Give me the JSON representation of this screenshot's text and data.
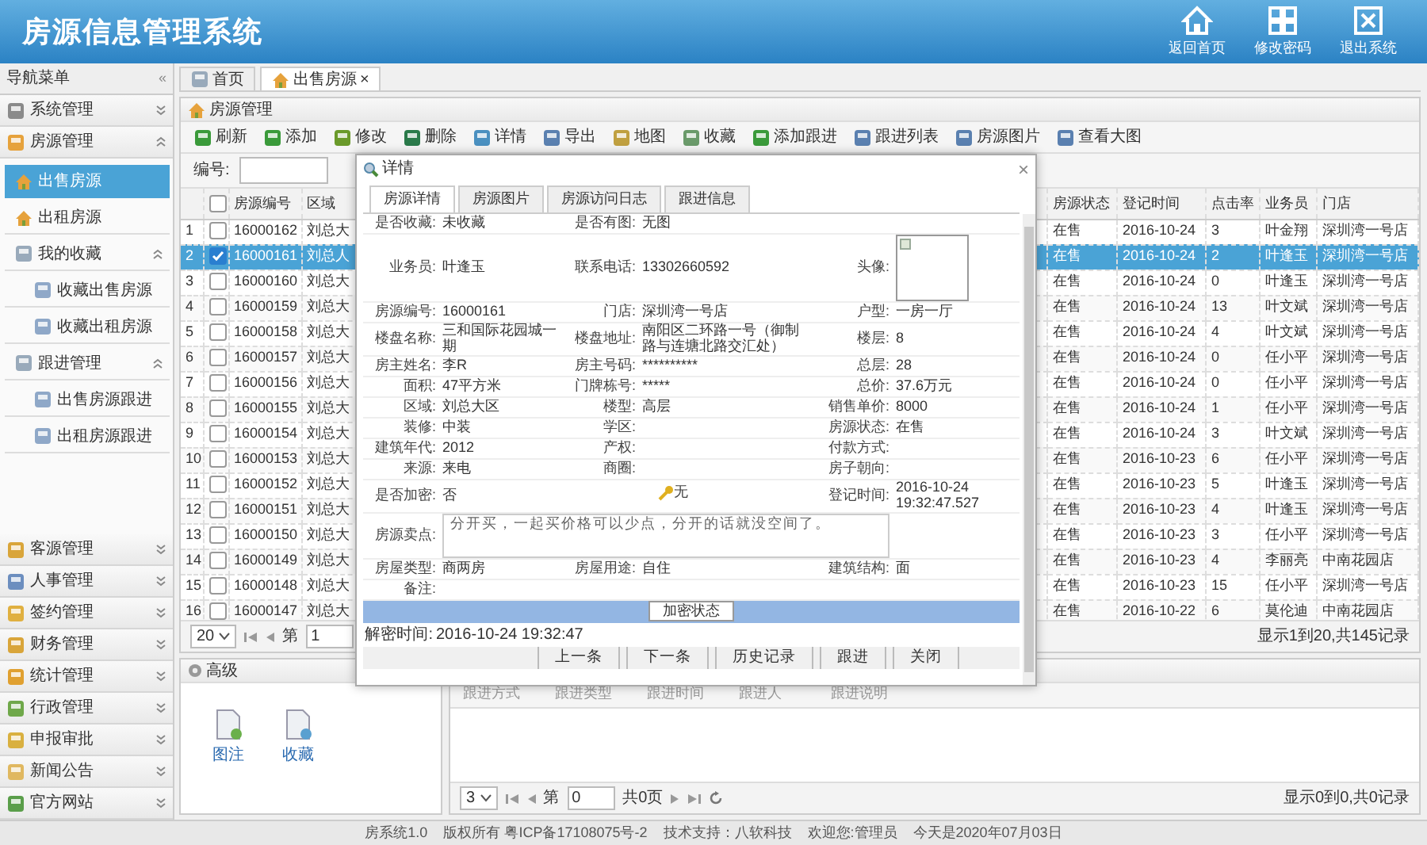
{
  "app_title": "房源信息管理系统",
  "header_buttons": [
    {
      "label": "返回首页"
    },
    {
      "label": "修改密码"
    },
    {
      "label": "退出系统"
    }
  ],
  "sidebar": {
    "title": "导航菜单",
    "collapse": "«",
    "sections": [
      {
        "label": "系统管理",
        "expanded": false
      },
      {
        "label": "房源管理",
        "expanded": true,
        "children": [
          {
            "label": "出售房源",
            "selected": true
          },
          {
            "label": "出租房源",
            "selected": false
          },
          {
            "label": "我的收藏",
            "selected": false,
            "expanded": true,
            "children": [
              {
                "label": "收藏出售房源",
                "selected": false
              },
              {
                "label": "收藏出租房源",
                "selected": false
              }
            ]
          },
          {
            "label": "跟进管理",
            "selected": false,
            "expanded": true,
            "children": [
              {
                "label": "出售房源跟进",
                "selected": false
              },
              {
                "label": "出租房源跟进",
                "selected": false
              }
            ]
          }
        ]
      },
      {
        "label": "客源管理",
        "expanded": false
      },
      {
        "label": "人事管理",
        "expanded": false
      },
      {
        "label": "签约管理",
        "expanded": false
      },
      {
        "label": "财务管理",
        "expanded": false
      },
      {
        "label": "统计管理",
        "expanded": false
      },
      {
        "label": "行政管理",
        "expanded": false
      },
      {
        "label": "申报审批",
        "expanded": false
      },
      {
        "label": "新闻公告",
        "expanded": false
      },
      {
        "label": "官方网站",
        "expanded": false
      }
    ]
  },
  "tabs": [
    {
      "label": "首页",
      "selected": false,
      "closable": false
    },
    {
      "label": "出售房源",
      "selected": true,
      "closable": true,
      "close": "×"
    }
  ],
  "panel_title": "房源管理",
  "toolbar": [
    "刷新",
    "添加",
    "修改",
    "删除",
    "详情",
    "导出",
    "地图",
    "收藏",
    "添加跟进",
    "跟进列表",
    "房源图片",
    "查看大图"
  ],
  "search": {
    "label": "编号:"
  },
  "table": {
    "all_checked": false,
    "columns": [
      "房源编号",
      "区域",
      "房源状态",
      "登记时间",
      "点击率",
      "业务员",
      "门店"
    ],
    "rows": [
      {
        "index": "1",
        "checked": false,
        "selected": false,
        "cells": [
          "16000162",
          "刘总大",
          "在售",
          "2016-10-24",
          "3",
          "叶金翔",
          "深圳湾一号店"
        ]
      },
      {
        "index": "2",
        "checked": true,
        "selected": true,
        "cells": [
          "16000161",
          "刘总人",
          "在售",
          "2016-10-24",
          "2",
          "叶逢玉",
          "深圳湾一号店"
        ]
      },
      {
        "index": "3",
        "checked": false,
        "selected": false,
        "cells": [
          "16000160",
          "刘总大",
          "在售",
          "2016-10-24",
          "0",
          "叶逢玉",
          "深圳湾一号店"
        ]
      },
      {
        "index": "4",
        "checked": false,
        "selected": false,
        "cells": [
          "16000159",
          "刘总大",
          "在售",
          "2016-10-24",
          "13",
          "叶文斌",
          "深圳湾一号店"
        ]
      },
      {
        "index": "5",
        "checked": false,
        "selected": false,
        "cells": [
          "16000158",
          "刘总大",
          "在售",
          "2016-10-24",
          "4",
          "叶文斌",
          "深圳湾一号店"
        ]
      },
      {
        "index": "6",
        "checked": false,
        "selected": false,
        "cells": [
          "16000157",
          "刘总大",
          "在售",
          "2016-10-24",
          "0",
          "任小平",
          "深圳湾一号店"
        ]
      },
      {
        "index": "7",
        "checked": false,
        "selected": false,
        "cells": [
          "16000156",
          "刘总大",
          "在售",
          "2016-10-24",
          "0",
          "任小平",
          "深圳湾一号店"
        ]
      },
      {
        "index": "8",
        "checked": false,
        "selected": false,
        "cells": [
          "16000155",
          "刘总大",
          "在售",
          "2016-10-24",
          "1",
          "任小平",
          "深圳湾一号店"
        ]
      },
      {
        "index": "9",
        "checked": false,
        "selected": false,
        "cells": [
          "16000154",
          "刘总大",
          "在售",
          "2016-10-24",
          "3",
          "叶文斌",
          "深圳湾一号店"
        ]
      },
      {
        "index": "10",
        "checked": false,
        "selected": false,
        "cells": [
          "16000153",
          "刘总大",
          "在售",
          "2016-10-23",
          "6",
          "任小平",
          "深圳湾一号店"
        ]
      },
      {
        "index": "11",
        "checked": false,
        "selected": false,
        "cells": [
          "16000152",
          "刘总大",
          "在售",
          "2016-10-23",
          "5",
          "叶逢玉",
          "深圳湾一号店"
        ]
      },
      {
        "index": "12",
        "checked": false,
        "selected": false,
        "cells": [
          "16000151",
          "刘总大",
          "在售",
          "2016-10-23",
          "4",
          "叶逢玉",
          "深圳湾一号店"
        ]
      },
      {
        "index": "13",
        "checked": false,
        "selected": false,
        "cells": [
          "16000150",
          "刘总大",
          "在售",
          "2016-10-23",
          "3",
          "任小平",
          "深圳湾一号店"
        ]
      },
      {
        "index": "14",
        "checked": false,
        "selected": false,
        "cells": [
          "16000149",
          "刘总大",
          "在售",
          "2016-10-23",
          "4",
          "李丽亮",
          "中南花园店"
        ]
      },
      {
        "index": "15",
        "checked": false,
        "selected": false,
        "cells": [
          "16000148",
          "刘总大",
          "在售",
          "2016-10-23",
          "15",
          "任小平",
          "深圳湾一号店"
        ]
      },
      {
        "index": "16",
        "checked": false,
        "selected": false,
        "cells": [
          "16000147",
          "刘总大",
          "在售",
          "2016-10-22",
          "6",
          "莫伦迪",
          "中南花园店"
        ]
      }
    ]
  },
  "pager": {
    "page_size": "20",
    "page_label": "第",
    "page": "1",
    "summary": "显示1到20,共145记录"
  },
  "lower": {
    "title": "高级",
    "actions": [
      "图注",
      "收藏"
    ],
    "columns": [
      "跟进方式",
      "跟进类型",
      "跟进时间",
      "跟进人",
      "跟进说明"
    ],
    "pager": {
      "page_size": "3",
      "page_label": "第",
      "page": "0",
      "total": "共0页",
      "summary": "显示0到0,共0记录"
    }
  },
  "dialog": {
    "title": "详情",
    "close": "×",
    "tabs": [
      {
        "label": "房源详情",
        "selected": true
      },
      {
        "label": "房源图片",
        "selected": false
      },
      {
        "label": "房源访问日志",
        "selected": false
      },
      {
        "label": "跟进信息",
        "selected": false
      }
    ],
    "rows": [
      [
        {
          "label": "是否收藏:",
          "value": "未收藏"
        },
        {
          "label": "是否有图:",
          "value": "无图"
        },
        {
          "kind": "empty"
        }
      ],
      [
        {
          "label": "业务员:",
          "value": "叶逢玉"
        },
        {
          "label": "联系电话:",
          "value": "13302660592"
        },
        {
          "kind": "avatar",
          "label": "头像:"
        }
      ],
      [
        {
          "label": "房源编号:",
          "value": "16000161"
        },
        {
          "label": "门店:",
          "value": "深圳湾一号店"
        },
        {
          "label": "户型:",
          "value": "一房一厅"
        }
      ],
      [
        {
          "label": "楼盘名称:",
          "value": "三和国际花园城一期"
        },
        {
          "label": "楼盘地址:",
          "value": "南阳区二环路一号（御制路与连塘北路交汇处）"
        },
        {
          "label": "楼层:",
          "value": "8"
        }
      ],
      [
        {
          "label": "房主姓名:",
          "value": "李R"
        },
        {
          "label": "房主号码:",
          "value": "**********"
        },
        {
          "label": "总层:",
          "value": "28"
        }
      ],
      [
        {
          "label": "面积:",
          "value": "47平方米"
        },
        {
          "label": "门牌栋号:",
          "value": "*****"
        },
        {
          "label": "总价:",
          "value": "37.6万元"
        }
      ],
      [
        {
          "label": "区域:",
          "value": "刘总大区"
        },
        {
          "label": "楼型:",
          "value": "高层"
        },
        {
          "label": "销售单价:",
          "value": "8000"
        }
      ],
      [
        {
          "label": "装修:",
          "value": "中装"
        },
        {
          "label": "学区:"
        },
        {
          "label": "房源状态:",
          "value": "在售"
        }
      ],
      [
        {
          "label": "建筑年代:",
          "value": "2012"
        },
        {
          "label": "产权:"
        },
        {
          "label": "付款方式:"
        }
      ],
      [
        {
          "label": "来源:",
          "value": "来电"
        },
        {
          "label": "商圈:"
        },
        {
          "label": "房子朝向:"
        }
      ],
      [
        {
          "label": "是否加密:",
          "value": "否"
        },
        {
          "kind": "key",
          "value": "无"
        },
        {
          "label": "登记时间:",
          "value": "2016-10-24 19:32:47.527"
        }
      ]
    ],
    "selling_point": {
      "label": "房源卖点:",
      "value": "分开买，一起买价格可以少点，分开的话就没空间了。"
    },
    "rows_after": [
      [
        {
          "label": "房屋类型:",
          "value": "商两房"
        },
        {
          "label": "房屋用途:",
          "value": "自住"
        },
        {
          "label": "建筑结构:",
          "value": "面"
        }
      ]
    ],
    "remark": {
      "label": "备注:"
    },
    "status_button": "加密状态",
    "decrypt": {
      "label": "解密时间:",
      "value": "2016-10-24 19:32:47"
    },
    "buttons": [
      "上一条",
      "下一条",
      "历史记录",
      "跟进",
      "关闭"
    ]
  },
  "footer": [
    "房系统1.0",
    "版权所有 粤ICP备17108075号-2",
    "技术支持：八软科技",
    "欢迎您:管理员",
    "今天是2020年07月03日"
  ]
}
